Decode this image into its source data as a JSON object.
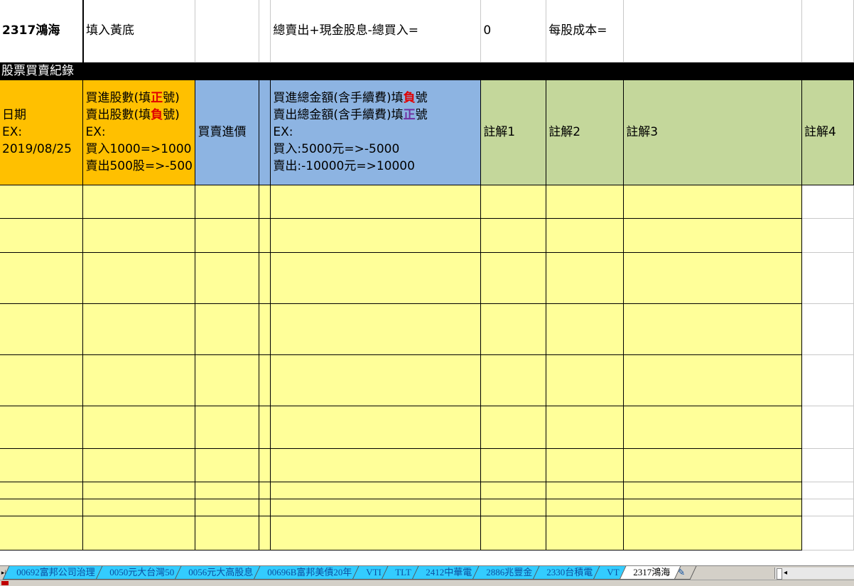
{
  "top_row": {
    "stock": "2317鴻海",
    "instruction": "填入黃底",
    "formula_label": "總賣出+現金股息-總買入=",
    "formula_value": "0",
    "cost_label": "每股成本="
  },
  "section_title": "股票買賣紀錄",
  "headers": {
    "date": [
      "日期",
      "EX:",
      "2019/08/25"
    ],
    "shares": {
      "line1_pre": "買進股數(填",
      "line1_mark": "正",
      "line1_post": "號)",
      "line2_pre": "賣出股數(填",
      "line2_mark": "負",
      "line2_post": "號)",
      "line3": "EX:",
      "line4": "買入1000=>1000",
      "line5": "賣出500股=>-500"
    },
    "price": "買賣進價",
    "amount": {
      "line1_pre": "買進總金額(含手續費)填",
      "line1_mark": "負",
      "line1_post": "號",
      "line2_pre": "賣出總金額(含手續費)填",
      "line2_mark": "正",
      "line2_post": "號",
      "line3": "EX:",
      "line4": "買入:5000元=>-5000",
      "line5": "賣出:-10000元=>10000"
    },
    "note1": "註解1",
    "note2": "註解2",
    "note3": "註解3",
    "note4": "註解4"
  },
  "sheet_tabs": [
    "00692富邦公司治理",
    "0050元大台灣50",
    "0056元大高股息",
    "00696B富邦美債20年",
    "VTI",
    "TLT",
    "2412中華電",
    "2886兆豐金",
    "2330台積電",
    "VT",
    "2317鴻海"
  ],
  "active_tab": "2317鴻海",
  "colors": {
    "orange": "#ffc000",
    "blue": "#8db4e2",
    "green": "#c4d79b",
    "yellow": "#ffff99",
    "tab": "#33ccff"
  }
}
